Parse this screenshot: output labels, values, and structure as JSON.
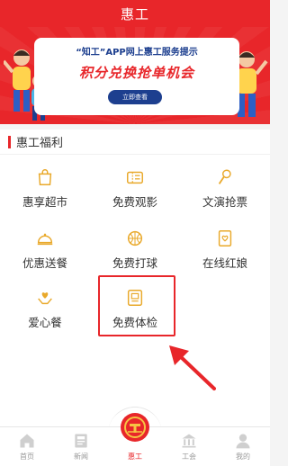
{
  "header": {
    "title": "惠工"
  },
  "banner": {
    "line1": "“知工”APP网上惠工服务提示",
    "line2": "积分兑换抢单机会",
    "button": "立即查看"
  },
  "section": {
    "title": "惠工福利",
    "items": [
      {
        "label": "惠享超市",
        "icon": "shopping-bag-icon"
      },
      {
        "label": "免费观影",
        "icon": "film-ticket-icon"
      },
      {
        "label": "文演抢票",
        "icon": "microphone-icon"
      },
      {
        "label": "优惠送餐",
        "icon": "food-cloche-icon"
      },
      {
        "label": "免费打球",
        "icon": "ball-icon"
      },
      {
        "label": "在线红娘",
        "icon": "love-letter-icon"
      },
      {
        "label": "爱心餐",
        "icon": "heart-hands-icon"
      },
      {
        "label": "免费体检",
        "icon": "health-check-icon"
      }
    ]
  },
  "tabbar": {
    "tabs": [
      {
        "label": "首页",
        "icon": "home-icon"
      },
      {
        "label": "新闻",
        "icon": "news-icon"
      },
      {
        "label": "惠工",
        "icon": "union-emblem-icon",
        "active": true
      },
      {
        "label": "工会",
        "icon": "building-icon"
      },
      {
        "label": "我的",
        "icon": "user-icon"
      }
    ]
  },
  "colors": {
    "brand_red": "#e8262a",
    "icon_gold": "#e9a92b",
    "banner_blue": "#1d3f8f"
  }
}
